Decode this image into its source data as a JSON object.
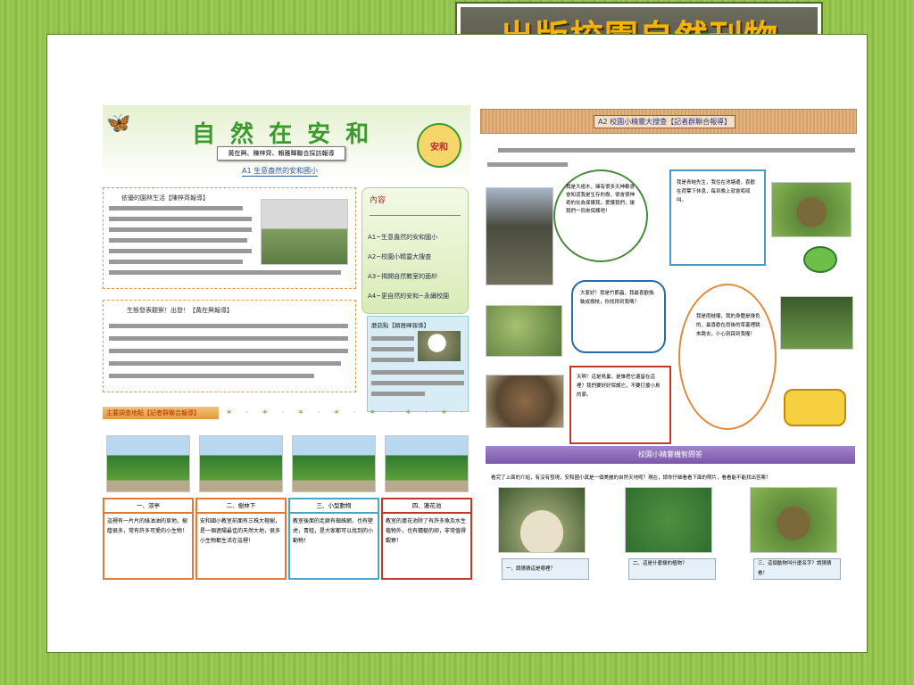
{
  "slide": {
    "title": "出版校園自然刊物",
    "colors": {
      "title_text": "#f5b400",
      "title_bg": "#606055",
      "frame": "#4f6b2a"
    }
  },
  "left_page": {
    "masthead": "自 然 在 安 和",
    "authors": "黃在興、陳梓齊、賴雅暉聯合採訪報導",
    "subtitle": "A1 生意盎然的安和國小",
    "section1_title": "依優的園林生活【陳梓齊報導】",
    "toc": {
      "heading": "內容",
      "items": [
        "A1~生意盎然的安和國小",
        "A2~校園小精靈大搜查",
        "A3~揭開自然教室的面紗",
        "A4~更自然的安和~永續校園"
      ]
    },
    "section2_title": "生態發表觀察！出發！【黃在興報導】",
    "mushroom_title": "蘑菇點【賴雅暉報導】",
    "bar_title": "主要調查地點【記者群聯合報導】",
    "spots": [
      {
        "label": "一、涼亭",
        "text": "這裡有一片片的綠油油的草地，樹蔭很多，常有許多可愛的小生物！",
        "color": "#e07a3a"
      },
      {
        "label": "二、樹林下",
        "text": "安和國小教室前面有三株大榕樹，是一個遮陽最佳的天然大地，很多小生物都生活在這裡！",
        "color": "#e07a3a"
      },
      {
        "label": "三、小型動物",
        "text": "教室後面的走廊有蜘蛛網，也有壁虎，青蛙，是大家都可以找到的小動物！",
        "color": "#4da3c8"
      },
      {
        "label": "四、蓮花池",
        "text": "教室的蓮花池除了有許多魚及水生植物外，也有蜻蜓的卵，非常值得觀察！",
        "color": "#c0392b"
      }
    ]
  },
  "right_page": {
    "header": "A2 校園小精靈大搜查【記者群聯合報導】",
    "bubbles": [
      "我是大祖木，擁有很多天神都會會知道我是生存的樹，很會很神奇的化為保護我，愛護我們，讓我們一同來保護吧！",
      "我是青蛙先生，我住在池塘邊，喜歡在荷葉下休息，每到晚上就會呱呱叫。",
      "大家好！我是竹節蟲，我最喜歡偽裝成樹枝，你找得到我嗎？",
      "我是雨蛙喔，我的身體是綠色的，最喜歡在雨後的草叢裡跳來跳去，小心別踩到我喔！",
      "天啊！這是鳥巢，是誰把它遺留在這裡？我們要好好保護它，不要打擾小鳥的家。"
    ],
    "quiz_header": "校園小精靈機智問答",
    "quiz_intro": "看完了上面的介紹，有沒有發現，安和國小真是一個美麗的自然天地呢？現在，請你仔細看看下面的照片，看看能不能找出答案！",
    "quiz_items": [
      "一、請猜猜這是哪裡？",
      "二、這是什麼樣的植物？",
      "三、這個動物叫什麼名字？請猜猜看！"
    ],
    "colors": {
      "header_bg": "#d9a36a",
      "quiz_bg": "#8a68b8"
    }
  }
}
